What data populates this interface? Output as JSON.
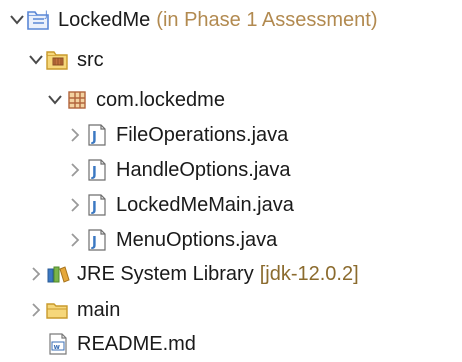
{
  "tree": {
    "project": {
      "label": "LockedMe",
      "meta": "(in Phase 1 Assessment)",
      "icon": "java-project-icon",
      "expanded": true
    },
    "src": {
      "label": "src",
      "icon": "source-folder-icon",
      "expanded": true
    },
    "package": {
      "label": "com.lockedme",
      "icon": "package-icon",
      "expanded": true
    },
    "files": [
      {
        "label": "FileOperations.java",
        "icon": "java-file-icon"
      },
      {
        "label": "HandleOptions.java",
        "icon": "java-file-icon"
      },
      {
        "label": "LockedMeMain.java",
        "icon": "java-file-icon"
      },
      {
        "label": "MenuOptions.java",
        "icon": "java-file-icon"
      }
    ],
    "jre": {
      "label": "JRE System Library",
      "meta": "[jdk-12.0.2]",
      "icon": "library-icon"
    },
    "main": {
      "label": "main",
      "icon": "folder-icon"
    },
    "readme": {
      "label": "README.md",
      "icon": "markdown-file-icon"
    }
  },
  "colors": {
    "chevron": "#4a4a4a",
    "java_file_blue": "#3b78c2",
    "folder_yellow": "#e8c567",
    "package_brown": "#b1643c",
    "project_blue": "#5a87d6",
    "meta_text": "#8b6b2e"
  }
}
